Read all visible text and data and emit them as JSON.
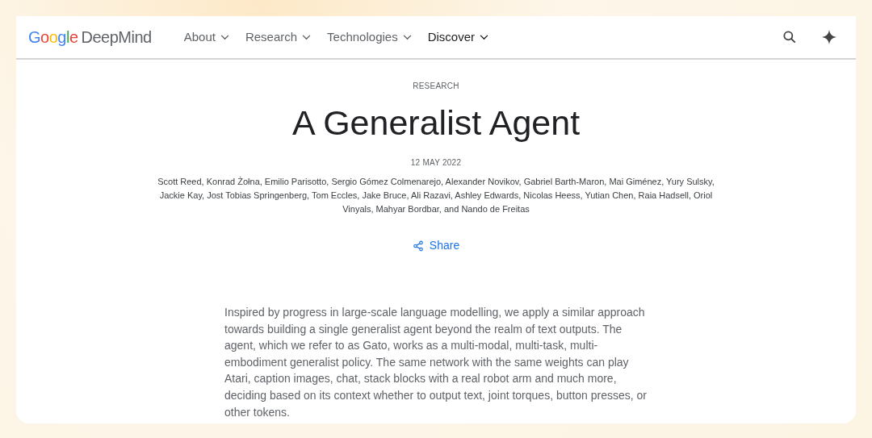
{
  "header": {
    "logo": {
      "brand": "Google",
      "product": "DeepMind"
    },
    "nav": [
      {
        "label": "About",
        "selected": false
      },
      {
        "label": "Research",
        "selected": false
      },
      {
        "label": "Technologies",
        "selected": false
      },
      {
        "label": "Discover",
        "selected": true
      }
    ]
  },
  "article": {
    "category": "RESEARCH",
    "title": "A Generalist Agent",
    "date": "12 MAY 2022",
    "authors": "Scott Reed, Konrad Żołna, Emilio Parisotto, Sergio Gómez Colmenarejo, Alexander Novikov, Gabriel Barth-Maron, Mai Giménez, Yury Sulsky, Jackie Kay, Jost Tobias Springenberg, Tom Eccles, Jake Bruce, Ali Razavi, Ashley Edwards, Nicolas Heess, Yutian Chen, Raia Hadsell, Oriol Vinyals, Mahyar Bordbar, and Nando de Freitas",
    "share": "Share",
    "body": "Inspired by progress in large-scale language modelling, we apply a similar approach towards building a single generalist agent beyond the realm of text outputs. The agent, which we refer to as Gato, works as a multi-modal, multi-task, multi-embodiment generalist policy. The same network with the same weights can play Atari, caption images, chat, stack blocks with a real robot arm and much more, deciding based on its context whether to output text, joint torques, button presses, or other tokens."
  }
}
